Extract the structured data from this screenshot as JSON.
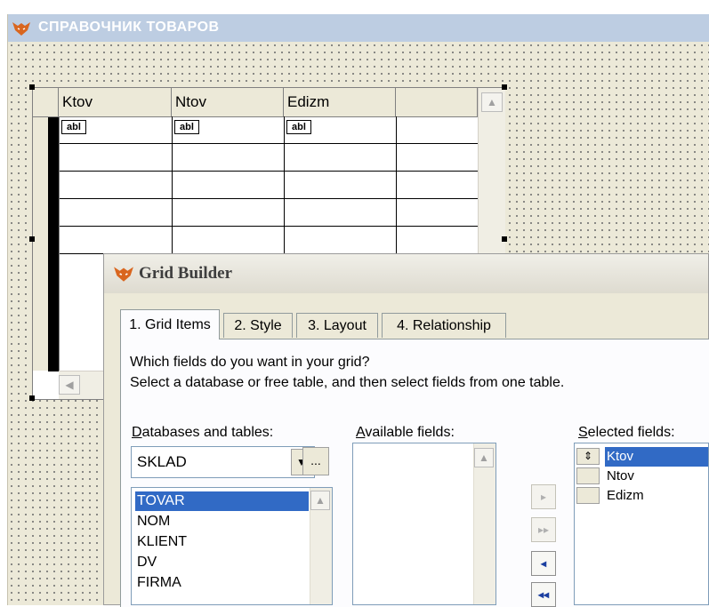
{
  "form": {
    "title": "СПРАВОЧНИК ТОВАРОВ",
    "grid": {
      "columns": [
        "Ktov",
        "Ntov",
        "Edizm"
      ],
      "cell_control_label": "abl"
    }
  },
  "dialog": {
    "title": "Grid Builder",
    "tabs": [
      "1. Grid Items",
      "2. Style",
      "3. Layout",
      "4. Relationship"
    ],
    "active_tab": 0,
    "instruction_line1": "Which fields do you want in your grid?",
    "instruction_line2": "Select a database or free table, and then select fields from one table.",
    "databases_label_accel": "D",
    "databases_label_rest": "atabases and tables:",
    "available_label_accel": "A",
    "available_label_rest": "vailable fields:",
    "selected_label_accel": "S",
    "selected_label_rest": "elected fields:",
    "database_value": "SKLAD",
    "ellipsis_label": "...",
    "tables": [
      "TOVAR",
      "NOM",
      "KLIENT",
      "DV",
      "FIRMA"
    ],
    "selected_table": "TOVAR",
    "selected_fields": [
      "Ktov",
      "Ntov",
      "Edizm"
    ],
    "move_buttons": {
      "add_one": "▸",
      "add_all": "▸▸",
      "remove_one": "◂",
      "remove_all": "◂◂"
    }
  }
}
